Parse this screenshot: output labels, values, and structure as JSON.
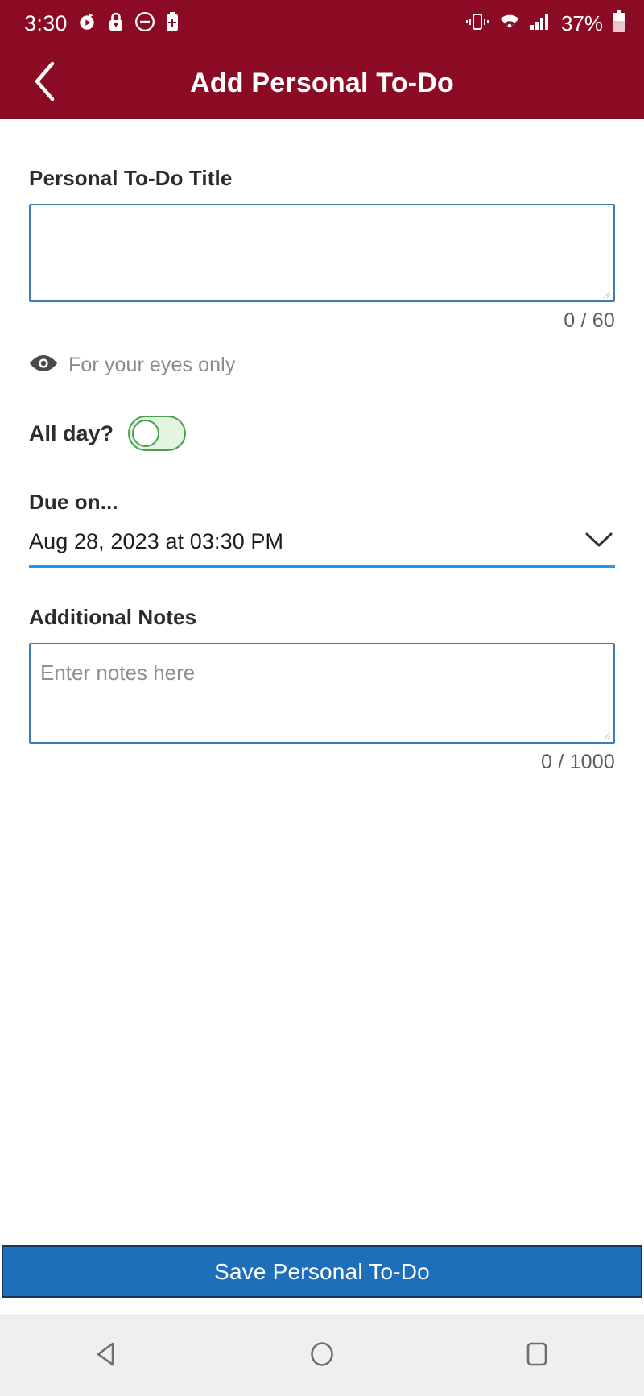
{
  "status_bar": {
    "time": "3:30",
    "battery_percent": "37%",
    "icons": [
      "alarm-timer-icon",
      "lock-icon",
      "do-not-disturb-icon",
      "battery-saver-icon",
      "vibrate-icon",
      "wifi-icon",
      "cellular-signal-icon",
      "battery-icon"
    ],
    "colors": {
      "background": "#8C0B24",
      "foreground": "#ffffff"
    }
  },
  "app_bar": {
    "title": "Add Personal To-Do",
    "back_icon": "chevron-left-icon",
    "background": "#8C0B24"
  },
  "form": {
    "title_field": {
      "label": "Personal To-Do Title",
      "value": "",
      "placeholder": "",
      "counter": "0 / 60",
      "border_color": "#3d7cb5"
    },
    "privacy": {
      "icon": "eye-icon",
      "text": "For your eyes only"
    },
    "all_day": {
      "label": "All day?",
      "checked": false,
      "track_color": "#e3f5e0",
      "accent_color": "#4a9e4f"
    },
    "due_on": {
      "label": "Due on...",
      "value": "Aug 28, 2023 at 03:30 PM",
      "chevron_icon": "chevron-down-icon",
      "underline_color": "#2196F3"
    },
    "notes_field": {
      "label": "Additional Notes",
      "value": "",
      "placeholder": "Enter notes here",
      "counter": "0 / 1000",
      "border_color": "#3d7cb5"
    }
  },
  "save_button": {
    "label": "Save Personal To-Do",
    "background": "#1d6fba"
  },
  "nav_bar": {
    "back_label": "back-triangle-icon",
    "home_label": "home-circle-icon",
    "recents_label": "recents-square-icon",
    "background": "#efefef"
  }
}
